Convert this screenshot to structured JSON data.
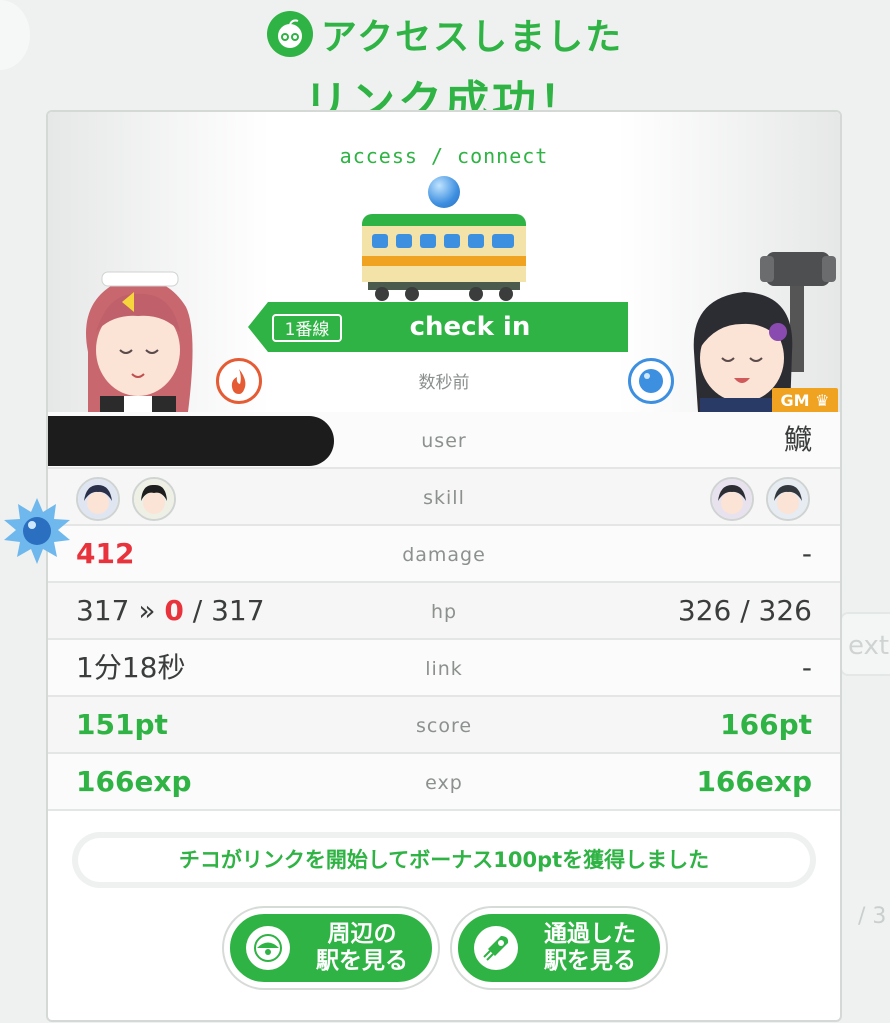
{
  "header": {
    "title_line1": "アクセスしました",
    "title_line2": "リンク成功！",
    "app_icon": "app-logo-icon"
  },
  "checkin_panel": {
    "access_label": "access / connect",
    "line_badge": "1番線",
    "action_label": "check in",
    "time_ago": "数秒前",
    "left_attribute_icon": "fire-icon",
    "right_attribute_icon": "water-icon",
    "gm_badge": "GM"
  },
  "stats": {
    "user": {
      "label": "user",
      "left": "",
      "right": "鱵"
    },
    "skill": {
      "label": "skill",
      "left": "",
      "right": ""
    },
    "damage": {
      "label": "damage",
      "left": "412",
      "right": "-"
    },
    "hp": {
      "label": "hp",
      "left_before": "317 » ",
      "left_zero": "0",
      "left_after": " / 317",
      "right": "326 / 326"
    },
    "link": {
      "label": "link",
      "left": "1分18秒",
      "right": "-"
    },
    "score": {
      "label": "score",
      "left": "151pt",
      "right": "166pt"
    },
    "exp": {
      "label": "exp",
      "left": "166exp",
      "right": "166exp"
    }
  },
  "notice": "チコがリンクを開始してボーナス100ptを獲得しました",
  "buttons": {
    "nearby_stations": "周辺の\n駅を見る",
    "passed_stations": "通過した\n駅を見る"
  },
  "colors": {
    "accent_green": "#2fb344",
    "damage_red": "#e8323c",
    "fire": "#e55b34",
    "water": "#3d8fe0",
    "gm": "#f0a320"
  }
}
